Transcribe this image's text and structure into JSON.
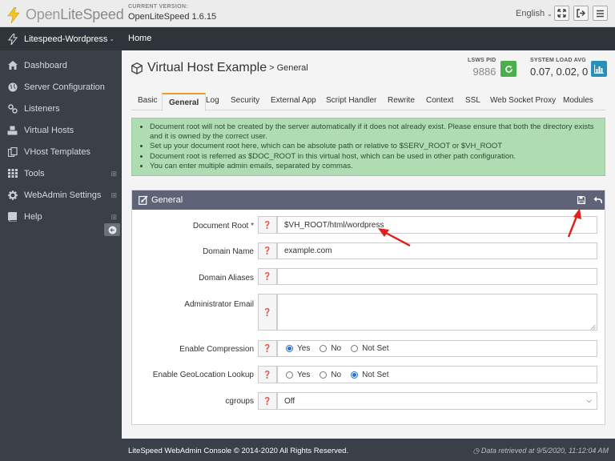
{
  "header": {
    "logo_text_1": "Open",
    "logo_text_2": "LiteSpeed",
    "version_label": "CURRENT VERSION:",
    "version_value": "OpenLiteSpeed 1.6.15",
    "language": "English"
  },
  "sidebar": {
    "site_selector": "Litespeed-Wordpress",
    "items": [
      {
        "label": "Dashboard",
        "icon": "home-icon"
      },
      {
        "label": "Server Configuration",
        "icon": "globe-icon"
      },
      {
        "label": "Listeners",
        "icon": "link-icon"
      },
      {
        "label": "Virtual Hosts",
        "icon": "cubes-icon"
      },
      {
        "label": "VHost Templates",
        "icon": "copy-icon"
      },
      {
        "label": "Tools",
        "icon": "grid-icon"
      },
      {
        "label": "WebAdmin Settings",
        "icon": "gear-icon"
      },
      {
        "label": "Help",
        "icon": "book-icon"
      }
    ]
  },
  "breadcrumb": {
    "home": "Home"
  },
  "page": {
    "title": "Virtual Host Example",
    "subtitle": "> General",
    "pid_label": "LSWS PID",
    "pid_value": "9886",
    "load_label": "SYSTEM LOAD AVG",
    "load_value": "0.07, 0.02, 0"
  },
  "tabs": [
    "Basic",
    "General",
    "Log",
    "Security",
    "External App",
    "Script Handler",
    "Rewrite",
    "Context",
    "SSL",
    "Web Socket Proxy",
    "Modules"
  ],
  "active_tab": "General",
  "alert": {
    "items": [
      "Document root will not be created by the server automatically if it does not already exist. Please ensure that both the directory exists and it is owned by the correct user.",
      "Set up your document root here, which can be absolute path or relative to $SERV_ROOT or $VH_ROOT",
      "Document root is referred as $DOC_ROOT in this virtual host, which can be used in other path configuration.",
      "You can enter multiple admin emails, separated by commas."
    ]
  },
  "panel": {
    "title": "General",
    "fields": {
      "document_root": {
        "label": "Document Root *",
        "value": "$VH_ROOT/html/wordpress"
      },
      "domain_name": {
        "label": "Domain Name",
        "value": "example.com"
      },
      "domain_aliases": {
        "label": "Domain Aliases",
        "value": ""
      },
      "admin_email": {
        "label": "Administrator Email",
        "value": ""
      },
      "enable_compression": {
        "label": "Enable Compression",
        "options": [
          "Yes",
          "No",
          "Not Set"
        ],
        "selected": "Yes"
      },
      "enable_geolocation": {
        "label": "Enable GeoLocation Lookup",
        "options": [
          "Yes",
          "No",
          "Not Set"
        ],
        "selected": "Not Set"
      },
      "cgroups": {
        "label": "cgroups",
        "value": "Off"
      }
    }
  },
  "footer": {
    "copyright": "LiteSpeed WebAdmin Console © 2014-2020 All Rights Reserved.",
    "retrieved": "Data retrieved at 9/5/2020, 11:12:04 AM"
  },
  "colors": {
    "sidebar_bg": "#3a3f48",
    "panel_header": "#5e6377",
    "alert_bg": "#b0dcb4",
    "active_tab_accent": "#e8a024",
    "refresh_btn": "#4cae4c",
    "chart_btn": "#2a8fb8",
    "annotation_arrow": "#e0201c"
  }
}
